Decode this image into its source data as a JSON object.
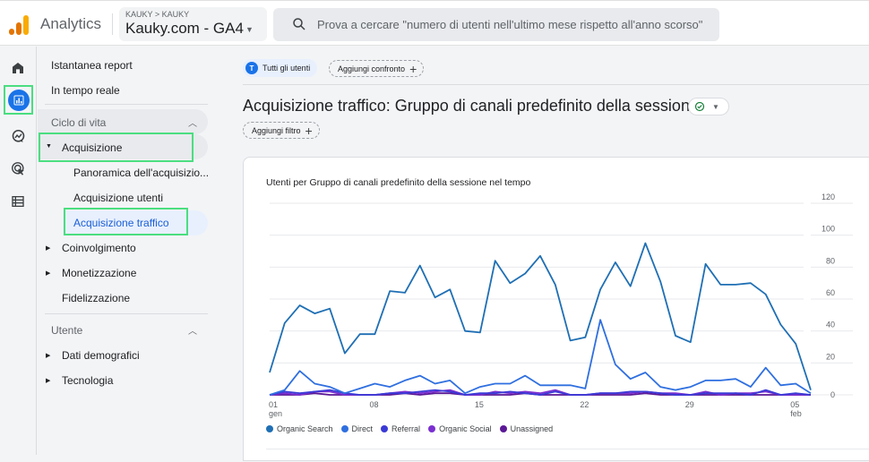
{
  "header": {
    "app_name": "Analytics",
    "property_breadcrumb": "KAUKY > KAUKY",
    "property_name": "Kauky.com - GA4",
    "search_placeholder": "Prova a cercare \"numero di utenti nell'ultimo mese rispetto all'anno scorso\""
  },
  "rail": {
    "items": [
      {
        "icon": "home-icon"
      },
      {
        "icon": "reports-icon",
        "active": true
      },
      {
        "icon": "explore-icon"
      },
      {
        "icon": "advertising-icon"
      },
      {
        "icon": "configure-icon"
      }
    ]
  },
  "nav": {
    "snapshot": "Istantanea report",
    "realtime": "In tempo reale",
    "lifecycle_section": "Ciclo di vita",
    "acquisition": "Acquisizione",
    "acq_overview": "Panoramica dell'acquisizio...",
    "acq_users": "Acquisizione utenti",
    "acq_traffic": "Acquisizione traffico",
    "engagement": "Coinvolgimento",
    "monetization": "Monetizzazione",
    "retention": "Fidelizzazione",
    "user_section": "Utente",
    "demographics": "Dati demografici",
    "technology": "Tecnologia"
  },
  "main": {
    "segment_chip": {
      "avatar": "T",
      "label": "Tutti gli utenti"
    },
    "add_comparison": "Aggiungi confronto",
    "page_title": "Acquisizione traffico: Gruppo di canali predefinito della sessione",
    "add_filter": "Aggiungi filtro"
  },
  "chart_data": {
    "type": "line",
    "title": "Utenti per Gruppo di canali predefinito della sessione nel tempo",
    "xlabel": "",
    "ylabel": "",
    "ylim": [
      0,
      120
    ],
    "yticks": [
      0,
      20,
      40,
      60,
      80,
      100,
      120
    ],
    "x_tick_labels": [
      {
        "day_index": 0,
        "label": "01",
        "sub": "gen"
      },
      {
        "day_index": 7,
        "label": "08",
        "sub": ""
      },
      {
        "day_index": 14,
        "label": "15",
        "sub": ""
      },
      {
        "day_index": 21,
        "label": "22",
        "sub": ""
      },
      {
        "day_index": 28,
        "label": "29",
        "sub": ""
      },
      {
        "day_index": 35,
        "label": "05",
        "sub": "feb"
      }
    ],
    "x_count": 37,
    "grid": true,
    "legend_position": "bottom-left",
    "series": [
      {
        "name": "Organic Search",
        "color": "#1f6fb4",
        "values": [
          14,
          45,
          56,
          51,
          54,
          26,
          38,
          38,
          65,
          64,
          81,
          61,
          66,
          40,
          39,
          84,
          70,
          76,
          87,
          69,
          34,
          36,
          66,
          83,
          68,
          95,
          71,
          37,
          33,
          82,
          69,
          69,
          70,
          63,
          44,
          32,
          3
        ]
      },
      {
        "name": "Direct",
        "color": "#2f6fe0",
        "values": [
          0,
          3,
          15,
          7,
          5,
          1,
          4,
          7,
          5,
          9,
          12,
          7,
          9,
          1,
          5,
          7,
          7,
          12,
          6,
          6,
          6,
          4,
          47,
          19,
          10,
          14,
          5,
          3,
          5,
          9,
          9,
          10,
          5,
          17,
          6,
          7,
          1
        ]
      },
      {
        "name": "Referral",
        "color": "#3a3ad6",
        "values": [
          0,
          2,
          1,
          2,
          3,
          1,
          0,
          0,
          1,
          1,
          2,
          3,
          2,
          0,
          1,
          1,
          2,
          1,
          0,
          2,
          0,
          0,
          1,
          1,
          2,
          2,
          1,
          0,
          0,
          1,
          1,
          1,
          0,
          3,
          0,
          1,
          0
        ]
      },
      {
        "name": "Organic Social",
        "color": "#7b2fd0",
        "values": [
          0,
          1,
          0,
          2,
          2,
          0,
          0,
          0,
          1,
          2,
          1,
          2,
          3,
          0,
          0,
          2,
          1,
          2,
          1,
          3,
          0,
          0,
          1,
          1,
          1,
          2,
          1,
          1,
          0,
          2,
          0,
          1,
          1,
          2,
          0,
          0,
          0
        ]
      },
      {
        "name": "Unassigned",
        "color": "#5b1896",
        "values": [
          0,
          0,
          0,
          1,
          0,
          0,
          0,
          0,
          0,
          1,
          0,
          1,
          1,
          0,
          0,
          0,
          0,
          1,
          0,
          0,
          0,
          0,
          0,
          0,
          0,
          1,
          0,
          0,
          0,
          0,
          0,
          0,
          0,
          0,
          0,
          0,
          0
        ]
      }
    ]
  }
}
